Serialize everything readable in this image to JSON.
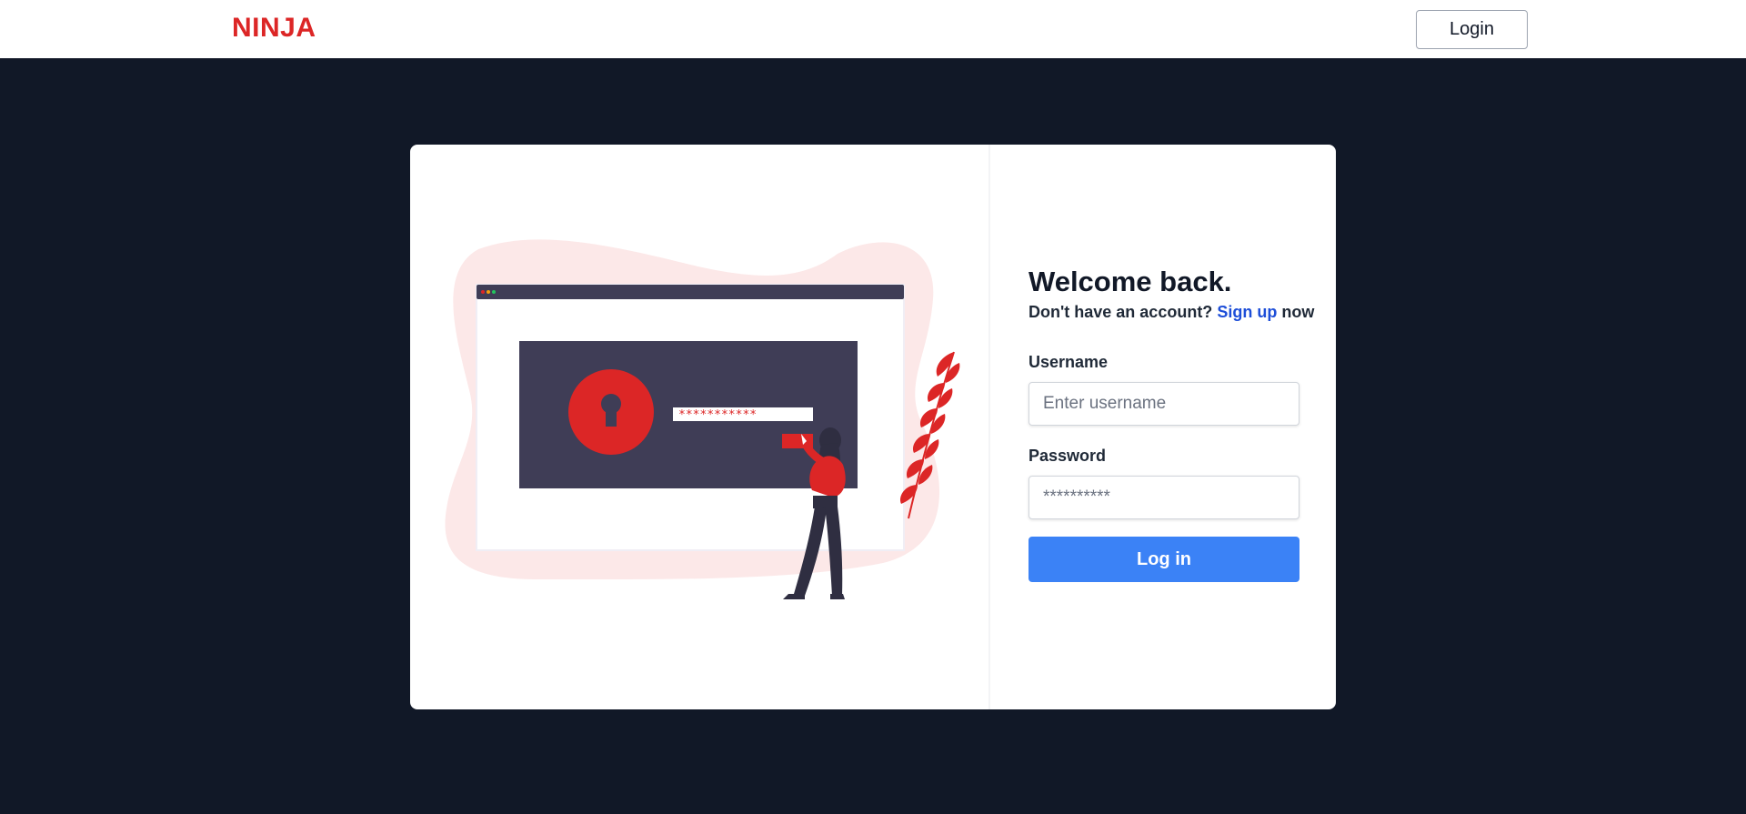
{
  "navbar": {
    "brand": "NINJA",
    "login_label": "Login"
  },
  "colors": {
    "brand": "#dc2626",
    "background": "#111827",
    "accent_blue": "#3b82f6",
    "link_blue": "#1d4ed8",
    "illustration_dark": "#3f3d56",
    "illustration_blob": "#fce8e8"
  },
  "illustration": {
    "password_mask": "***********",
    "icons": [
      "lock-keyhole-icon",
      "browser-window",
      "person-figure",
      "fern-leaf"
    ]
  },
  "form": {
    "heading": "Welcome back.",
    "prompt_text": "Don't have an account?",
    "signup_label": "Sign up",
    "prompt_suffix": "now",
    "username_label": "Username",
    "username_placeholder": "Enter username",
    "password_label": "Password",
    "password_placeholder": "**********",
    "submit_label": "Log in"
  }
}
